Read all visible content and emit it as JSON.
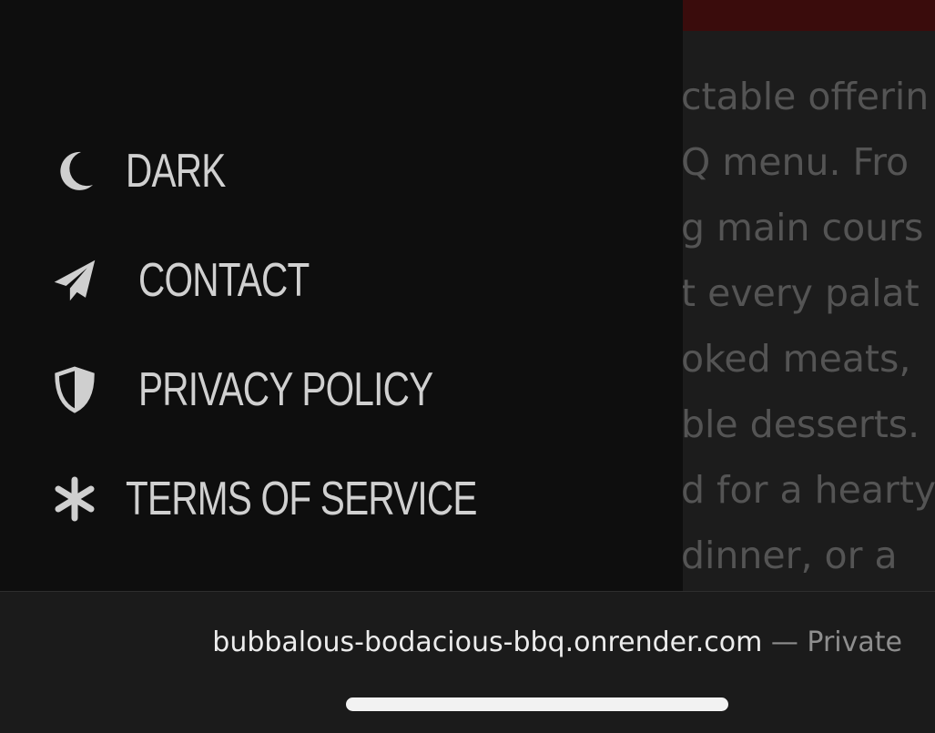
{
  "background_page": {
    "lines": [
      "ctable offerin",
      "Q menu. Fro",
      "g main cours",
      "t every palat",
      "oked meats,",
      "ble desserts.",
      "d for a hearty",
      "dinner, or a"
    ]
  },
  "menu": {
    "items": [
      {
        "label": "DARK",
        "icon": "moon-icon"
      },
      {
        "label": "CONTACT",
        "icon": "paper-plane-icon"
      },
      {
        "label": "PRIVACY POLICY",
        "icon": "shield-icon"
      },
      {
        "label": "TERMS OF SERVICE",
        "icon": "asterisk-icon"
      }
    ]
  },
  "browser": {
    "domain": "bubbalous-bodacious-bbq.onrender.com",
    "separator": "—",
    "mode": "Private"
  },
  "colors": {
    "drawer_bg": "#0e0e0e",
    "menu_text": "#d0d0d0",
    "banner": "#3a0c0c"
  }
}
